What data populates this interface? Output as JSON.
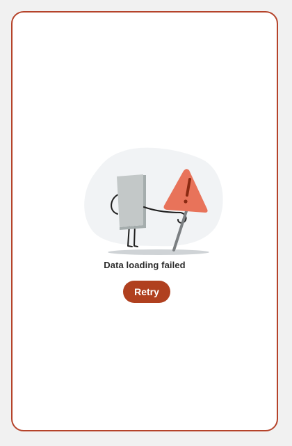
{
  "error_state": {
    "message": "Data loading failed",
    "retry_label": "Retry",
    "illustration_icon": "failed-data-warning-illustration",
    "colors": {
      "accent": "#b0401f",
      "border": "#b5432a",
      "warning_sign": "#e8735a",
      "document": "#c3c8c8"
    }
  }
}
